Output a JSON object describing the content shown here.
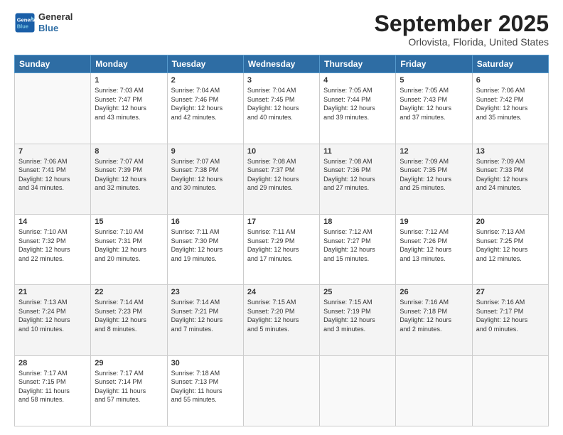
{
  "header": {
    "logo_line1": "General",
    "logo_line2": "Blue",
    "month": "September 2025",
    "location": "Orlovista, Florida, United States"
  },
  "weekdays": [
    "Sunday",
    "Monday",
    "Tuesday",
    "Wednesday",
    "Thursday",
    "Friday",
    "Saturday"
  ],
  "weeks": [
    [
      {
        "day": "",
        "info": ""
      },
      {
        "day": "1",
        "info": "Sunrise: 7:03 AM\nSunset: 7:47 PM\nDaylight: 12 hours\nand 43 minutes."
      },
      {
        "day": "2",
        "info": "Sunrise: 7:04 AM\nSunset: 7:46 PM\nDaylight: 12 hours\nand 42 minutes."
      },
      {
        "day": "3",
        "info": "Sunrise: 7:04 AM\nSunset: 7:45 PM\nDaylight: 12 hours\nand 40 minutes."
      },
      {
        "day": "4",
        "info": "Sunrise: 7:05 AM\nSunset: 7:44 PM\nDaylight: 12 hours\nand 39 minutes."
      },
      {
        "day": "5",
        "info": "Sunrise: 7:05 AM\nSunset: 7:43 PM\nDaylight: 12 hours\nand 37 minutes."
      },
      {
        "day": "6",
        "info": "Sunrise: 7:06 AM\nSunset: 7:42 PM\nDaylight: 12 hours\nand 35 minutes."
      }
    ],
    [
      {
        "day": "7",
        "info": "Sunrise: 7:06 AM\nSunset: 7:41 PM\nDaylight: 12 hours\nand 34 minutes."
      },
      {
        "day": "8",
        "info": "Sunrise: 7:07 AM\nSunset: 7:39 PM\nDaylight: 12 hours\nand 32 minutes."
      },
      {
        "day": "9",
        "info": "Sunrise: 7:07 AM\nSunset: 7:38 PM\nDaylight: 12 hours\nand 30 minutes."
      },
      {
        "day": "10",
        "info": "Sunrise: 7:08 AM\nSunset: 7:37 PM\nDaylight: 12 hours\nand 29 minutes."
      },
      {
        "day": "11",
        "info": "Sunrise: 7:08 AM\nSunset: 7:36 PM\nDaylight: 12 hours\nand 27 minutes."
      },
      {
        "day": "12",
        "info": "Sunrise: 7:09 AM\nSunset: 7:35 PM\nDaylight: 12 hours\nand 25 minutes."
      },
      {
        "day": "13",
        "info": "Sunrise: 7:09 AM\nSunset: 7:33 PM\nDaylight: 12 hours\nand 24 minutes."
      }
    ],
    [
      {
        "day": "14",
        "info": "Sunrise: 7:10 AM\nSunset: 7:32 PM\nDaylight: 12 hours\nand 22 minutes."
      },
      {
        "day": "15",
        "info": "Sunrise: 7:10 AM\nSunset: 7:31 PM\nDaylight: 12 hours\nand 20 minutes."
      },
      {
        "day": "16",
        "info": "Sunrise: 7:11 AM\nSunset: 7:30 PM\nDaylight: 12 hours\nand 19 minutes."
      },
      {
        "day": "17",
        "info": "Sunrise: 7:11 AM\nSunset: 7:29 PM\nDaylight: 12 hours\nand 17 minutes."
      },
      {
        "day": "18",
        "info": "Sunrise: 7:12 AM\nSunset: 7:27 PM\nDaylight: 12 hours\nand 15 minutes."
      },
      {
        "day": "19",
        "info": "Sunrise: 7:12 AM\nSunset: 7:26 PM\nDaylight: 12 hours\nand 13 minutes."
      },
      {
        "day": "20",
        "info": "Sunrise: 7:13 AM\nSunset: 7:25 PM\nDaylight: 12 hours\nand 12 minutes."
      }
    ],
    [
      {
        "day": "21",
        "info": "Sunrise: 7:13 AM\nSunset: 7:24 PM\nDaylight: 12 hours\nand 10 minutes."
      },
      {
        "day": "22",
        "info": "Sunrise: 7:14 AM\nSunset: 7:23 PM\nDaylight: 12 hours\nand 8 minutes."
      },
      {
        "day": "23",
        "info": "Sunrise: 7:14 AM\nSunset: 7:21 PM\nDaylight: 12 hours\nand 7 minutes."
      },
      {
        "day": "24",
        "info": "Sunrise: 7:15 AM\nSunset: 7:20 PM\nDaylight: 12 hours\nand 5 minutes."
      },
      {
        "day": "25",
        "info": "Sunrise: 7:15 AM\nSunset: 7:19 PM\nDaylight: 12 hours\nand 3 minutes."
      },
      {
        "day": "26",
        "info": "Sunrise: 7:16 AM\nSunset: 7:18 PM\nDaylight: 12 hours\nand 2 minutes."
      },
      {
        "day": "27",
        "info": "Sunrise: 7:16 AM\nSunset: 7:17 PM\nDaylight: 12 hours\nand 0 minutes."
      }
    ],
    [
      {
        "day": "28",
        "info": "Sunrise: 7:17 AM\nSunset: 7:15 PM\nDaylight: 11 hours\nand 58 minutes."
      },
      {
        "day": "29",
        "info": "Sunrise: 7:17 AM\nSunset: 7:14 PM\nDaylight: 11 hours\nand 57 minutes."
      },
      {
        "day": "30",
        "info": "Sunrise: 7:18 AM\nSunset: 7:13 PM\nDaylight: 11 hours\nand 55 minutes."
      },
      {
        "day": "",
        "info": ""
      },
      {
        "day": "",
        "info": ""
      },
      {
        "day": "",
        "info": ""
      },
      {
        "day": "",
        "info": ""
      }
    ]
  ]
}
